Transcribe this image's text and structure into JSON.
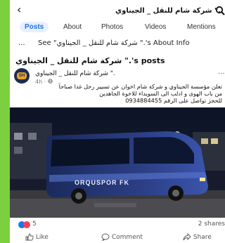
{
  "header": {
    "back_icon": "back-arrow-icon",
    "page_name": "شركة شام للنقل _ الجيناوي \".",
    "search_icon": "search-icon"
  },
  "tabs": [
    {
      "label": "Posts",
      "active": true
    },
    {
      "label": "About",
      "active": false
    },
    {
      "label": "Photos",
      "active": false
    },
    {
      "label": "Videos",
      "active": false
    },
    {
      "label": "Mentions",
      "active": false
    }
  ],
  "about": {
    "dots": "...",
    "see_text": "See \"شركة شام للنقل _ الجيناوي \".'s About Info"
  },
  "posts_heading": "شركة شام للنقل _ الجيناوي \".'s posts",
  "post": {
    "author": "شركة شام للنقل _ الجيناوي \".",
    "time": "4h · ",
    "more": "···",
    "text_lines": [
      "تعلن مؤسسة الجيناوي و شركة شام اخوان عن تسيير رحل غدا صباحاً",
      "من باب الهوى و ادلب الى السويداء للاخوة الجاهدين",
      "للحجز تواصل على الرقم 0934884455"
    ],
    "bus_text": "ORQUSPOR FK"
  },
  "reactions": {
    "count": "5",
    "shares": "2 shares"
  },
  "actions": {
    "like": "Like",
    "comment": "Comment",
    "share": "Share"
  },
  "colors": {
    "background": "#7ccf3f",
    "accent": "#1a73e8"
  }
}
